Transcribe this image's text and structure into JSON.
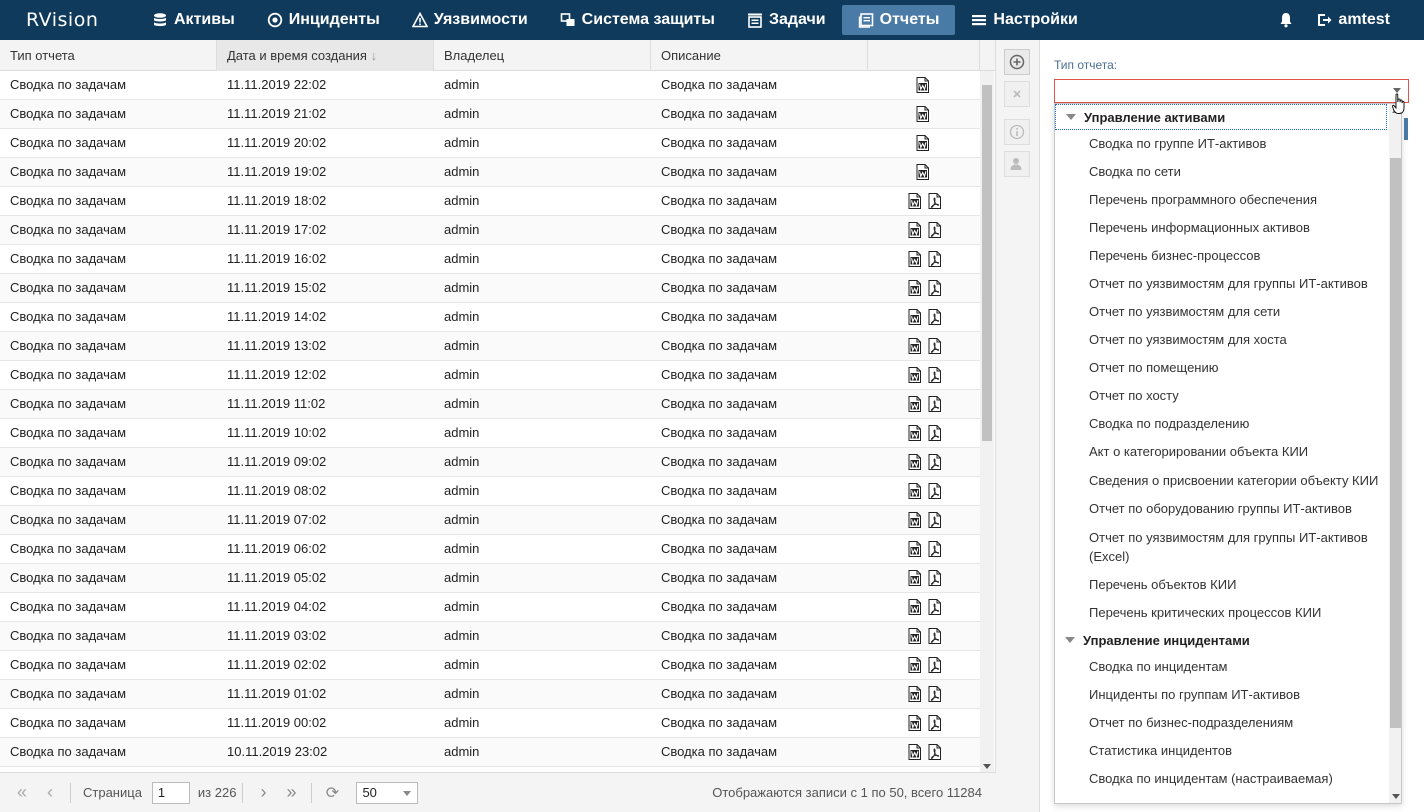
{
  "navbar": {
    "brand": "RVision",
    "items": [
      {
        "label": "Активы",
        "icon": "database-icon"
      },
      {
        "label": "Инциденты",
        "icon": "target-icon"
      },
      {
        "label": "Уязвимости",
        "icon": "warning-icon"
      },
      {
        "label": "Система защиты",
        "icon": "windows-icon"
      },
      {
        "label": "Задачи",
        "icon": "tasks-icon"
      },
      {
        "label": "Отчеты",
        "icon": "reports-icon",
        "active": true
      },
      {
        "label": "Настройки",
        "icon": "menu-icon"
      }
    ],
    "user": "amtest"
  },
  "table": {
    "headers": [
      "Тип отчета",
      "Дата и время создания",
      "Владелец",
      "Описание",
      ""
    ],
    "sort_indicator": "↓",
    "rows": [
      {
        "type": "Сводка по задачам",
        "date": "11.11.2019 22:02",
        "owner": "admin",
        "desc": "Сводка по задачам",
        "files": [
          "word"
        ]
      },
      {
        "type": "Сводка по задачам",
        "date": "11.11.2019 21:02",
        "owner": "admin",
        "desc": "Сводка по задачам",
        "files": [
          "word"
        ]
      },
      {
        "type": "Сводка по задачам",
        "date": "11.11.2019 20:02",
        "owner": "admin",
        "desc": "Сводка по задачам",
        "files": [
          "word"
        ]
      },
      {
        "type": "Сводка по задачам",
        "date": "11.11.2019 19:02",
        "owner": "admin",
        "desc": "Сводка по задачам",
        "files": [
          "word"
        ]
      },
      {
        "type": "Сводка по задачам",
        "date": "11.11.2019 18:02",
        "owner": "admin",
        "desc": "Сводка по задачам",
        "files": [
          "word",
          "pdf"
        ]
      },
      {
        "type": "Сводка по задачам",
        "date": "11.11.2019 17:02",
        "owner": "admin",
        "desc": "Сводка по задачам",
        "files": [
          "word",
          "pdf"
        ]
      },
      {
        "type": "Сводка по задачам",
        "date": "11.11.2019 16:02",
        "owner": "admin",
        "desc": "Сводка по задачам",
        "files": [
          "word",
          "pdf"
        ]
      },
      {
        "type": "Сводка по задачам",
        "date": "11.11.2019 15:02",
        "owner": "admin",
        "desc": "Сводка по задачам",
        "files": [
          "word",
          "pdf"
        ]
      },
      {
        "type": "Сводка по задачам",
        "date": "11.11.2019 14:02",
        "owner": "admin",
        "desc": "Сводка по задачам",
        "files": [
          "word",
          "pdf"
        ]
      },
      {
        "type": "Сводка по задачам",
        "date": "11.11.2019 13:02",
        "owner": "admin",
        "desc": "Сводка по задачам",
        "files": [
          "word",
          "pdf"
        ]
      },
      {
        "type": "Сводка по задачам",
        "date": "11.11.2019 12:02",
        "owner": "admin",
        "desc": "Сводка по задачам",
        "files": [
          "word",
          "pdf"
        ]
      },
      {
        "type": "Сводка по задачам",
        "date": "11.11.2019 11:02",
        "owner": "admin",
        "desc": "Сводка по задачам",
        "files": [
          "word",
          "pdf"
        ]
      },
      {
        "type": "Сводка по задачам",
        "date": "11.11.2019 10:02",
        "owner": "admin",
        "desc": "Сводка по задачам",
        "files": [
          "word",
          "pdf"
        ]
      },
      {
        "type": "Сводка по задачам",
        "date": "11.11.2019 09:02",
        "owner": "admin",
        "desc": "Сводка по задачам",
        "files": [
          "word",
          "pdf"
        ]
      },
      {
        "type": "Сводка по задачам",
        "date": "11.11.2019 08:02",
        "owner": "admin",
        "desc": "Сводка по задачам",
        "files": [
          "word",
          "pdf"
        ]
      },
      {
        "type": "Сводка по задачам",
        "date": "11.11.2019 07:02",
        "owner": "admin",
        "desc": "Сводка по задачам",
        "files": [
          "word",
          "pdf"
        ]
      },
      {
        "type": "Сводка по задачам",
        "date": "11.11.2019 06:02",
        "owner": "admin",
        "desc": "Сводка по задачам",
        "files": [
          "word",
          "pdf"
        ]
      },
      {
        "type": "Сводка по задачам",
        "date": "11.11.2019 05:02",
        "owner": "admin",
        "desc": "Сводка по задачам",
        "files": [
          "word",
          "pdf"
        ]
      },
      {
        "type": "Сводка по задачам",
        "date": "11.11.2019 04:02",
        "owner": "admin",
        "desc": "Сводка по задачам",
        "files": [
          "word",
          "pdf"
        ]
      },
      {
        "type": "Сводка по задачам",
        "date": "11.11.2019 03:02",
        "owner": "admin",
        "desc": "Сводка по задачам",
        "files": [
          "word",
          "pdf"
        ]
      },
      {
        "type": "Сводка по задачам",
        "date": "11.11.2019 02:02",
        "owner": "admin",
        "desc": "Сводка по задачам",
        "files": [
          "word",
          "pdf"
        ]
      },
      {
        "type": "Сводка по задачам",
        "date": "11.11.2019 01:02",
        "owner": "admin",
        "desc": "Сводка по задачам",
        "files": [
          "word",
          "pdf"
        ]
      },
      {
        "type": "Сводка по задачам",
        "date": "11.11.2019 00:02",
        "owner": "admin",
        "desc": "Сводка по задачам",
        "files": [
          "word",
          "pdf"
        ]
      },
      {
        "type": "Сводка по задачам",
        "date": "10.11.2019 23:02",
        "owner": "admin",
        "desc": "Сводка по задачам",
        "files": [
          "word",
          "pdf"
        ]
      }
    ]
  },
  "pager": {
    "page_label": "Страница",
    "page": "1",
    "of_label": "из 226",
    "page_size": "50",
    "info": "Отображаются записи с 1 по 50, всего 11284"
  },
  "panel": {
    "label": "Тип отчета:",
    "value": "",
    "groups": [
      {
        "title": "Управление активами",
        "options": [
          "Сводка по группе ИТ-активов",
          "Сводка по сети",
          "Перечень программного обеспечения",
          "Перечень информационных активов",
          "Перечень бизнес-процессов",
          "Отчет по уязвимостям для группы ИТ-активов",
          "Отчет по уязвимостям для сети",
          "Отчет по уязвимостям для хоста",
          "Отчет по помещению",
          "Отчет по хосту",
          "Сводка по подразделению",
          "Акт о категорировании объекта КИИ",
          "Сведения о присвоении категории объекту КИИ",
          "Отчет по оборудованию группы ИТ-активов",
          "Отчет по уязвимостям для группы ИТ-активов (Excel)",
          "Перечень объектов КИИ",
          "Перечень критических процессов КИИ"
        ]
      },
      {
        "title": "Управление инцидентами",
        "options": [
          "Сводка по инцидентам",
          "Инциденты по группам ИТ-активов",
          "Отчет по бизнес-подразделениям",
          "Статистика инцидентов",
          "Сводка по инцидентам (настраиваемая)"
        ]
      }
    ]
  },
  "colors": {
    "navbar": "#0f3a5c",
    "active_tab": "#4a7aa6",
    "combo_border_error": "#e0534a"
  }
}
